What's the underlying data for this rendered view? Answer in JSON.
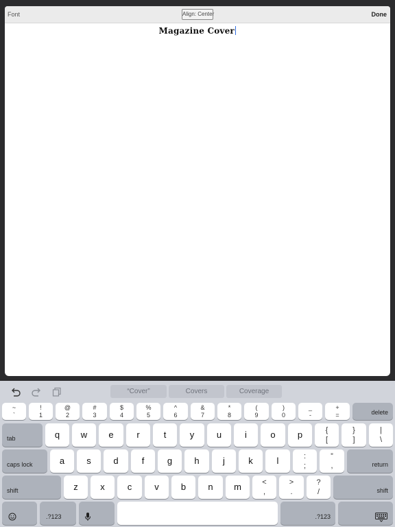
{
  "toolbar": {
    "font_label": "Font",
    "align_label": "Align: Center",
    "done_label": "Done"
  },
  "document": {
    "text": "Magazine Cover"
  },
  "suggestions": [
    "“Cover”",
    "Covers",
    "Coverage"
  ],
  "keys": {
    "row1": [
      {
        "t": "~",
        "b": "`"
      },
      {
        "t": "!",
        "b": "1"
      },
      {
        "t": "@",
        "b": "2"
      },
      {
        "t": "#",
        "b": "3"
      },
      {
        "t": "$",
        "b": "4"
      },
      {
        "t": "%",
        "b": "5"
      },
      {
        "t": "^",
        "b": "6"
      },
      {
        "t": "&",
        "b": "7"
      },
      {
        "t": "*",
        "b": "8"
      },
      {
        "t": "(",
        "b": "9"
      },
      {
        "t": ")",
        "b": "0"
      },
      {
        "t": "_",
        "b": "-"
      },
      {
        "t": "+",
        "b": "="
      }
    ],
    "delete": "delete",
    "tab": "tab",
    "row2": [
      "q",
      "w",
      "e",
      "r",
      "t",
      "y",
      "u",
      "i",
      "o",
      "p"
    ],
    "row2_sym": [
      {
        "t": "{",
        "b": "["
      },
      {
        "t": "}",
        "b": "]"
      },
      {
        "t": "|",
        "b": "\\"
      }
    ],
    "caps_lock": "caps lock",
    "row3": [
      "a",
      "s",
      "d",
      "f",
      "g",
      "h",
      "j",
      "k",
      "l"
    ],
    "row3_sym": [
      {
        "t": ":",
        "b": ";"
      },
      {
        "t": "”",
        "b": ","
      }
    ],
    "return": "return",
    "shift": "shift",
    "row4": [
      "z",
      "x",
      "c",
      "v",
      "b",
      "n",
      "m"
    ],
    "row4_sym": [
      {
        "t": "<",
        "b": ","
      },
      {
        "t": ">",
        "b": "."
      },
      {
        "t": "?",
        "b": "/"
      }
    ],
    "numbers_label": ".?123"
  },
  "icons": {
    "undo": "undo-icon",
    "redo": "redo-icon",
    "paste": "paste-icon",
    "emoji": "emoji-icon",
    "mic": "microphone-icon",
    "dismiss": "keyboard-dismiss-icon"
  },
  "colors": {
    "keyboard_bg": "#d1d4db",
    "key": "#ffffff",
    "key_dark": "#adb2bb",
    "caret": "#2f6de0"
  }
}
